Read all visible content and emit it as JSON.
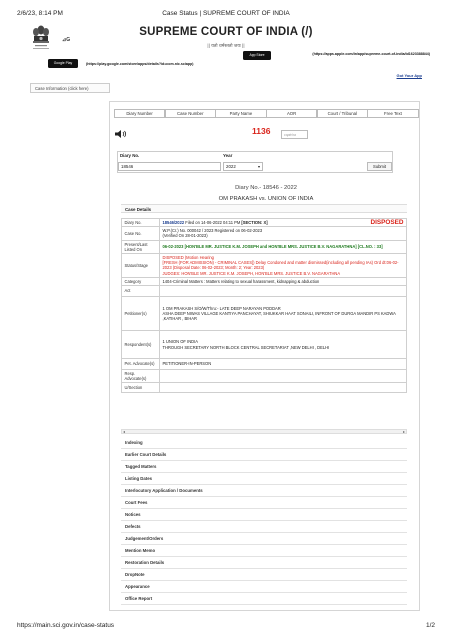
{
  "print": {
    "datetime": "2/6/23, 8:14 PM",
    "doc_title": "Case Status | SUPREME COURT OF INDIA",
    "url": "https://main.sci.gov.in/case-status",
    "page": "1/2"
  },
  "header": {
    "title": "SUPREME COURT OF INDIA (/)",
    "subtitle": "|| यतो धर्मस्ततो जयः ||",
    "android_link": "(https://play.google.com/store/apps/details?id=com.nic.sciapp)",
    "ios_link": "(https://apps.apple.com/in/app/supreme-court-of-india/id1623388844)",
    "got_your_app": "Got Your App",
    "google_play": "Google Play",
    "app_store": "App Store",
    "small_icon_text": "⊿G"
  },
  "case_info_button": "Case Information (click here)",
  "tabs": [
    "Diary Number",
    "Case Number",
    "Party Name",
    "AOR",
    "Court / Tribunal",
    "Free Text"
  ],
  "captcha": {
    "value": "1136",
    "placeholder": "captcha"
  },
  "form": {
    "diary_label": "Diary No.",
    "diary_value": "18546",
    "year_label": "Year",
    "year_value": "2022",
    "submit": "Submit"
  },
  "result": {
    "diary_line": "Diary No.- 18546 - 2022",
    "parties_line": "OM PRAKASH vs. UNION OF INDIA"
  },
  "case_details": {
    "header": "Case Details",
    "status_badge": "DISPOSED",
    "rows": [
      {
        "key": "Diary No.",
        "diary": "18546/2022",
        "filed": " Filed on 14-06-2022 04:11 PM ",
        "section": "[SECTION: X]"
      },
      {
        "key": "Case No.",
        "line1": "W.P.(Cr.) No. 000042 / 2023  Registered on 06-02-2023",
        "line2": "(Verified On 28-01-2023)"
      },
      {
        "key": "Present/Last Listed On",
        "value": "06-02-2023 [HON'BLE MR. JUSTICE K.M. JOSEPH and HON'BLE MRS. JUSTICE B.V. NAGARATHNA] [CL.NO. : 33]"
      },
      {
        "key": "Status/Stage",
        "line1": "DISPOSED (Motion Hearing",
        "line2": "[FRESH (FOR ADMISSION) - CRIMINAL CASES]) Delay Condoned and matter dismissed(including all pending IAs) Ord dt:06-02-2023 (Disposal Date: 06-02-2023; Month: 2; Year: 2023)",
        "line3": "JUDGES: HON'BLE MR. JUSTICE K.M. JOSEPH, HON'BLE MRS. JUSTICE B.V. NAGARATHNA"
      },
      {
        "key": "Category",
        "value": "1404-Criminal Matters : Matters relating to sexual harassment, kidnapping & abduction"
      },
      {
        "key": "Act",
        "value": ""
      },
      {
        "key": "Petitioner(s)",
        "line1": "1 OM PRAKASH S/O/W/Thru:- LATE DEEP NARAYAN PODDAR",
        "line2": "ASHA DEEP NIWAS VILLAGE KANTIYA PANCHAYAT, SHIUKKAR HAAT SONAILI, INFRONT OF DURGA MANDIR PS KADWA ,KATIHAR , BIHAR"
      },
      {
        "key": "Respondent(s)",
        "line1": "1 UNION OF INDIA",
        "line2": "THROUGH SECRETARY NORTH BLOCK CENTRAL SECRETARIAT ,NEW DELHI , DELHI"
      },
      {
        "key": "Pet. Advocate(s)",
        "value": "PETITIONER-IN-PERSON"
      },
      {
        "key": "Resp. Advocate(s)",
        "value": ""
      },
      {
        "key": "U/Section",
        "value": ""
      }
    ]
  },
  "sections": [
    "Indexing",
    "Earlier Court Details",
    "Tagged Matters",
    "Listing Dates",
    "Interlocutory Application / Documents",
    "Court Fees",
    "Notices",
    "Defects",
    "Judgement/Orders",
    "Mention Memo",
    "Restoration Details",
    "DropNote",
    "Appearance",
    "Office Report"
  ],
  "colors": {
    "accent_red": "#d9241b",
    "link_blue": "#1a3d8f",
    "bench_green": "#1e7a1e"
  },
  "icons": [
    "emblem-icon",
    "speaker-icon",
    "chevron-down-icon"
  ]
}
